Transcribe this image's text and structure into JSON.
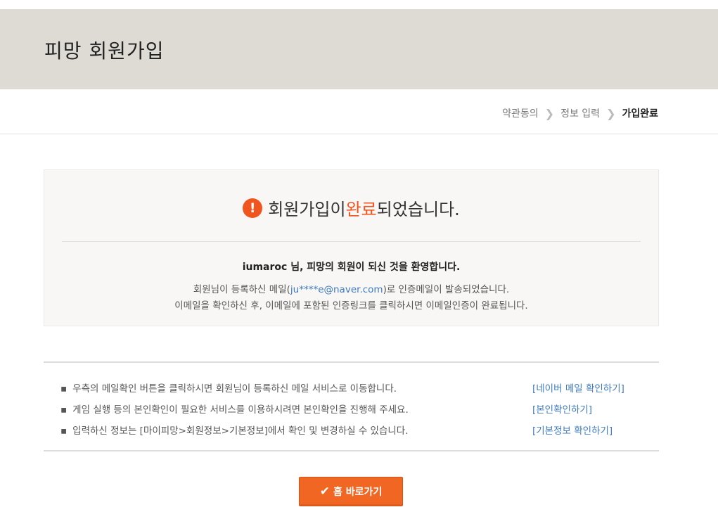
{
  "header": {
    "title": "피망 회원가입"
  },
  "steps": [
    {
      "label": "약관동의",
      "active": false
    },
    {
      "label": "정보 입력",
      "active": false
    },
    {
      "label": "가입완료",
      "active": true
    }
  ],
  "step_separator": "❯",
  "panel": {
    "alert_icon": "exclamation-icon",
    "title_prefix": "회원가입이 ",
    "title_accent": "완료",
    "title_suffix": "되었습니다.",
    "username": "iumaroc",
    "welcome_suffix": " 님, 피망의 회원이 되신 것을 환영합니다.",
    "msg1_prefix": "회원님이 등록하신 메일(",
    "email": "ju****e@naver.com",
    "msg1_suffix": ")로 인증메일이 발송되었습니다.",
    "msg2": "이메일을 확인하신 후, 이메일에 포함된 인증링크를 클릭하시면 이메일인증이 완료됩니다."
  },
  "info": [
    {
      "text": "우측의 메일확인 버튼을 클릭하시면 회원님이 등록하신 메일 서비스로 이동합니다.",
      "link": "[네이버 메일 확인하기]"
    },
    {
      "text": "게임 실행 등의 본인확인이 필요한 서비스를 이용하시려면 본인확인을 진행해 주세요.",
      "link": "[본인확인하기]"
    },
    {
      "text": "입력하신 정보는 [마이피망>회원정보>기본정보]에서 확인 및 변경하실 수 있습니다.",
      "link": "[기본정보 확인하기]"
    }
  ],
  "bullet": "▪",
  "home_button": {
    "label": "홈 바로가기",
    "icon": "check-icon"
  },
  "colors": {
    "accent": "#f0551f",
    "link": "#3f7bbf",
    "header_bg": "#dedbd4",
    "button": "#f06622"
  }
}
